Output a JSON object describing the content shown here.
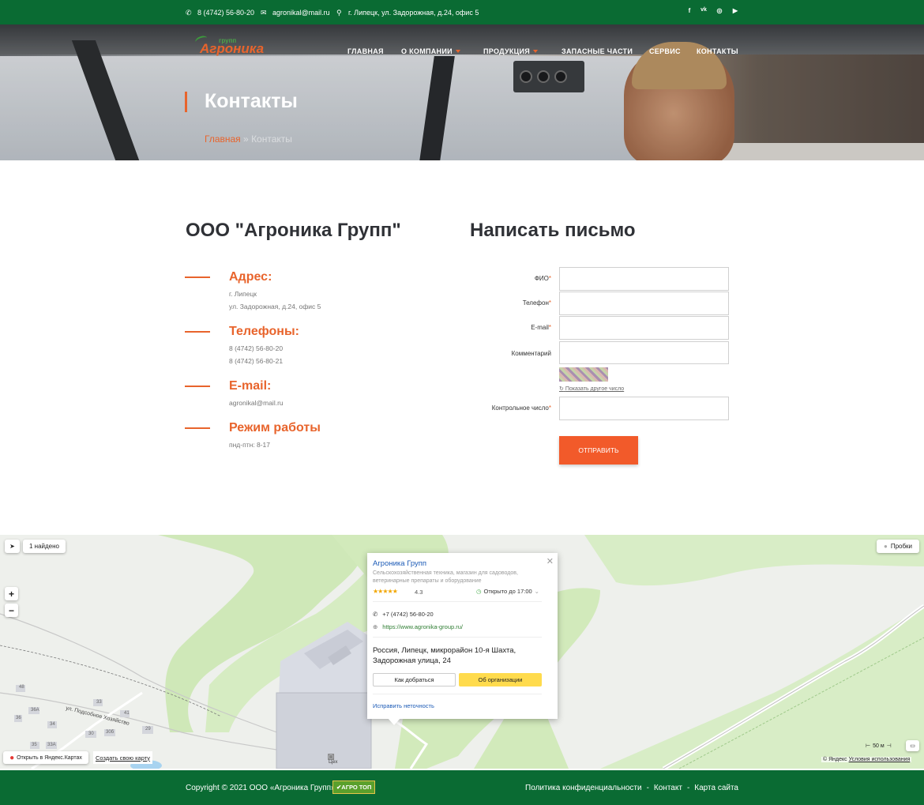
{
  "topbar": {
    "phone": "8 (4742) 56-80-20",
    "email": "agronikal@mail.ru",
    "address": "г. Липецк, ул. Задорожная, д.24, офис 5",
    "social": [
      "f",
      "vk",
      "ig",
      "yt"
    ]
  },
  "logo": {
    "main": "Агроника",
    "sub": "групп"
  },
  "nav": {
    "items": [
      "ГЛАВНАЯ",
      "О КОМПАНИИ",
      "ПРОДУКЦИЯ",
      "ЗАПАСНЫЕ ЧАСТИ",
      "СЕРВИС",
      "КОНТАКТЫ"
    ]
  },
  "hero": {
    "title": "Контакты",
    "crumb_home": "Главная",
    "crumb_sep": "»",
    "crumb_current": "Контакты"
  },
  "company": {
    "name": "ООО \"Агроника Групп\"",
    "address_title": "Адрес:",
    "address_lines": [
      "г. Липецк",
      "ул. Задорожная, д.24, офис 5"
    ],
    "phones_title": "Телефоны:",
    "phones": [
      "8 (4742) 56-80-20",
      "8 (4742) 56-80-21"
    ],
    "email_title": "E-mail:",
    "email": "agronikal@mail.ru",
    "hours_title": "Режим работы",
    "hours": "пнд-птн: 8-17"
  },
  "form": {
    "title": "Написать письмо",
    "fio_label": "ФИО",
    "phone_label": "Телефон",
    "email_label": "E-mail",
    "comment_label": "Комментарий",
    "captcha_link": "Показать другое число",
    "control_label": "Контрольное число",
    "submit": "ОТПРАВИТЬ",
    "required_mark": "*"
  },
  "map": {
    "found": "1 найдено",
    "traffic": "Пробки",
    "zoom_in": "+",
    "zoom_out": "−",
    "street": "ул. Подсобное Хозяйство",
    "workshop": "Цех",
    "open_yandex": "Открыть в Яндекс.Картах",
    "create_map": "Создать свою карту",
    "scale": "50 м",
    "copyright": "© Яндекс",
    "terms": "Условия использования",
    "house_numbers": [
      "48",
      "33",
      "36А",
      "41",
      "36",
      "34",
      "29",
      "35",
      "33А",
      "30",
      "30б"
    ],
    "popup": {
      "name": "Агроника Групп",
      "category": "Сельскохозяйственная техника, магазин для садоводов, ветеринарные препараты и оборудование",
      "rating": "4.3",
      "open": "Открыто до 17:00",
      "phone": "+7 (4742) 56-80-20",
      "site": "https://www.agronika-group.ru/",
      "address": "Россия, Липецк, микрорайон 10-я Шахта, Задорожная улица, 24",
      "route_btn": "Как добраться",
      "about_btn": "Об организации",
      "fix": "Исправить неточность"
    }
  },
  "footer": {
    "copyright": "Copyright © 2021 ООО «Агроника Групп»",
    "badge": "АГРО ТОП",
    "links": [
      "Политика конфиденциальности",
      "Контакт",
      "Карта сайта"
    ],
    "sep": "-"
  },
  "colors": {
    "green": "#0a6b33",
    "orange": "#e8642c",
    "button": "#f25a2a",
    "yellow": "#ffdb4d"
  }
}
